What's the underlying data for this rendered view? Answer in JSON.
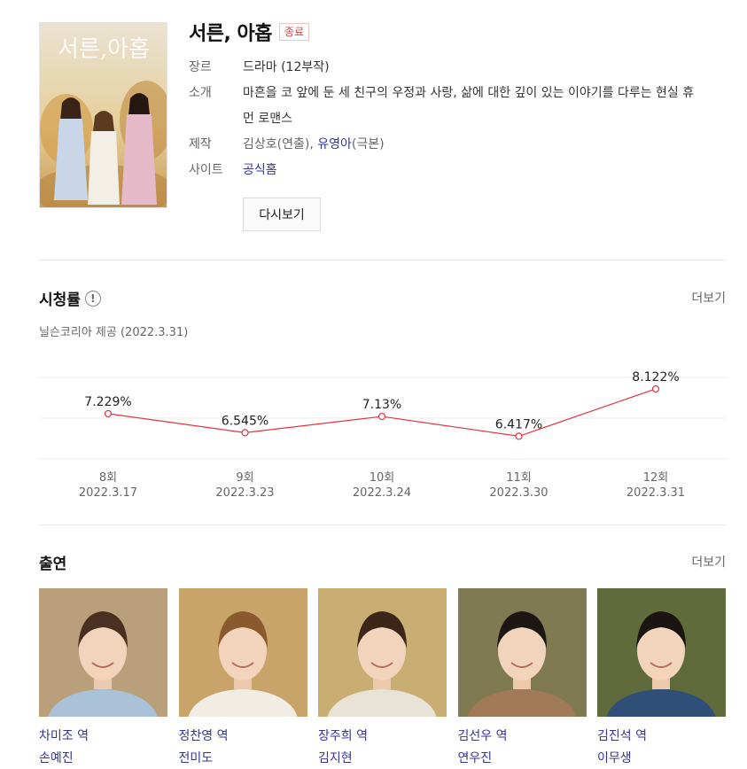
{
  "show": {
    "title": "서른, 아홉",
    "status": "종료",
    "poster_title": "서른,아홉",
    "info": [
      {
        "label": "장르",
        "value": "드라마 (12부작)"
      },
      {
        "label": "소개",
        "value": "마흔을 코 앞에 둔 세 친구의 우정과 사랑, 삶에 대한 깊이 있는 이야기를 다루는 현실 휴먼 로맨스"
      },
      {
        "label": "제작",
        "director": "김상호",
        "director_role": "(연출), ",
        "writer": "유영아",
        "writer_role": "(극본)"
      },
      {
        "label": "사이트",
        "value": "공식홈"
      }
    ],
    "rewatch_label": "다시보기"
  },
  "ratings": {
    "title": "시청률",
    "info_icon": "!",
    "more_label": "더보기",
    "source": "닐슨코리아 제공 (2022.3.31)"
  },
  "chart_data": {
    "type": "line",
    "series": [
      {
        "values": [
          7.229,
          6.545,
          7.13,
          6.417,
          8.122
        ]
      }
    ],
    "categories": [
      "8회",
      "9회",
      "10회",
      "11회",
      "12회"
    ],
    "dates": [
      "2022.3.17",
      "2022.3.23",
      "2022.3.24",
      "2022.3.30",
      "2022.3.31"
    ],
    "labels": [
      "7.229%",
      "6.545%",
      "7.13%",
      "6.417%",
      "8.122%"
    ],
    "ylim": [
      5.6,
      8.6
    ],
    "grid": true,
    "line_color": "#e8323c"
  },
  "cast": {
    "title": "출연",
    "more_label": "더보기",
    "members": [
      {
        "role": "차미조 역",
        "actor": "손예진",
        "bg": "#b9a07a",
        "hair": "#4a3020",
        "clothes": "#a9c2d8"
      },
      {
        "role": "정찬영 역",
        "actor": "전미도",
        "bg": "#c9a46a",
        "hair": "#8a5a2e",
        "clothes": "#f2ede4"
      },
      {
        "role": "장주희 역",
        "actor": "김지현",
        "bg": "#c8ae72",
        "hair": "#3c2618",
        "clothes": "#e9e2d6"
      },
      {
        "role": "김선우 역",
        "actor": "연우진",
        "bg": "#7f7a52",
        "hair": "#1c1712",
        "clothes": "#a07a56"
      },
      {
        "role": "김진석 역",
        "actor": "이무생",
        "bg": "#5f6b3a",
        "hair": "#1a1510",
        "clothes": "#2f4f78"
      }
    ]
  },
  "colors": {
    "link": "#33339f",
    "status": "#d6463c"
  }
}
